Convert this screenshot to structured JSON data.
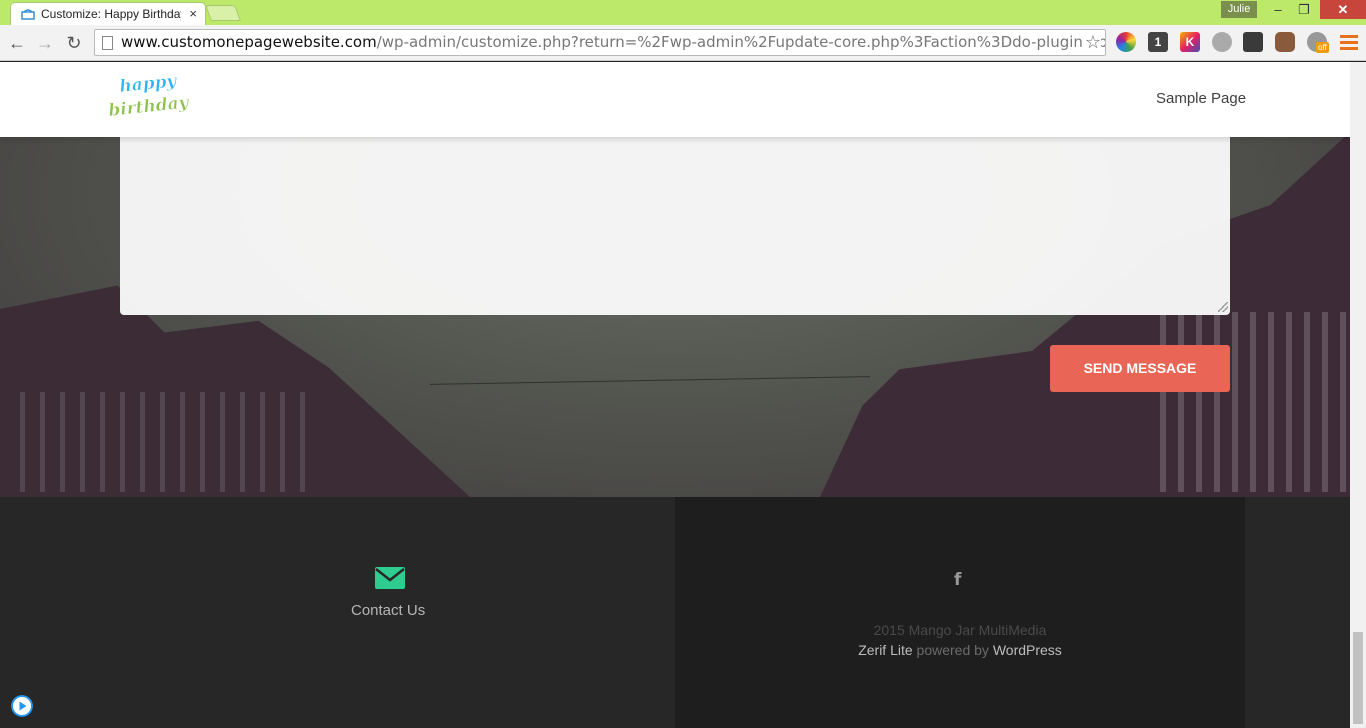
{
  "browser": {
    "tab_title": "Customize: Happy Birthday",
    "tab_close": "×",
    "user_name": "Julie",
    "win_min": "–",
    "win_max": "❐",
    "win_close": "✕",
    "url_host": "www.customonepagewebsite.com",
    "url_path": "/wp-admin/customize.php?return=%2Fwp-admin%2Fupdate-core.php%3Faction%3Ddo-plugin-upgrade",
    "ext_2_label": "1",
    "ext_3_label": "K",
    "ext_7_badge": "off",
    "accent": "#bde96b"
  },
  "site": {
    "logo_line1": "happy",
    "logo_line2": "birthday",
    "nav": [
      "Sample Page"
    ]
  },
  "contact": {
    "send_label": "SEND MESSAGE",
    "send_color": "#e96656"
  },
  "footer": {
    "contact_label": "Contact Us",
    "contact_icon": "envelope-icon",
    "contact_icon_color": "#2ecc8f",
    "social_icon": "facebook-icon",
    "social_glyph": "f",
    "copyright": "2015 Mango Jar MultiMedia",
    "theme_link": "Zerif Lite",
    "powered_by": " powered by ",
    "wp_link": "WordPress"
  }
}
